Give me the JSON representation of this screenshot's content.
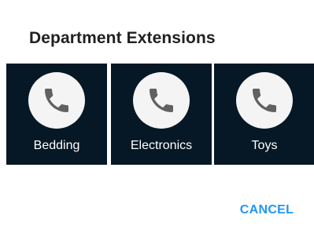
{
  "dialog": {
    "title": "Department Extensions",
    "departments": [
      {
        "label": "Bedding",
        "icon": "phone-icon"
      },
      {
        "label": "Electronics",
        "icon": "phone-icon"
      },
      {
        "label": "Toys",
        "icon": "phone-icon"
      }
    ],
    "cancel_label": "CANCEL"
  },
  "colors": {
    "tile_background": "#061826",
    "icon_circle": "#f4f4f4",
    "icon_glyph": "#616161",
    "accent": "#2196f3"
  }
}
